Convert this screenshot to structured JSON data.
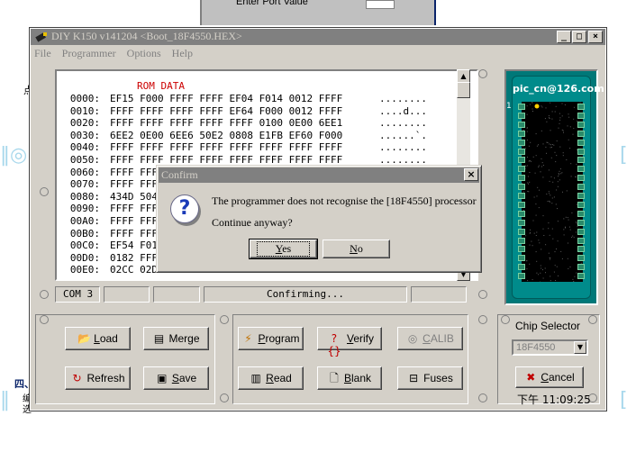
{
  "background": {
    "top_label": "Enter Port Value",
    "left_char": "点",
    "bottom_text_1": "四、",
    "bottom_text_2": "编",
    "bottom_text_3": "选"
  },
  "window": {
    "title": "DIY K150 v141204  <Boot_18F4550.HEX>",
    "menu": [
      "File",
      "Programmer",
      "Options",
      "Help"
    ]
  },
  "hex": {
    "title": "ROM DATA",
    "rows": [
      {
        "addr": "0000:",
        "data": "EF15 F000 FFFF FFFF EF04 F014 0012 FFFF",
        "ascii": "........"
      },
      {
        "addr": "0010:",
        "data": "FFFF FFFF FFFF FFFF EF64 F000 0012 FFFF",
        "ascii": "....d..."
      },
      {
        "addr": "0020:",
        "data": "FFFF FFFF FFFF FFFF FFFF 0100 0E00 6EE1",
        "ascii": "........"
      },
      {
        "addr": "0030:",
        "data": "6EE2 0E00 6EE6 50E2 0808 E1FB EF60 F000",
        "ascii": "......`."
      },
      {
        "addr": "0040:",
        "data": "FFFF FFFF FFFF FFFF FFFF FFFF FFFF FFFF",
        "ascii": "........"
      },
      {
        "addr": "0050:",
        "data": "FFFF FFFF FFFF FFFF FFFF FFFF FFFF FFFF",
        "ascii": "........"
      },
      {
        "addr": "0060:",
        "data": "FFFF FFF",
        "ascii": ""
      },
      {
        "addr": "0070:",
        "data": "FFFF FFF",
        "ascii": ""
      },
      {
        "addr": "0080:",
        "data": "434D 504",
        "ascii": ""
      },
      {
        "addr": "0090:",
        "data": "FFFF FFF",
        "ascii": ""
      },
      {
        "addr": "00A0:",
        "data": "FFFF FFF",
        "ascii": ""
      },
      {
        "addr": "00B0:",
        "data": "FFFF FFF",
        "ascii": ""
      },
      {
        "addr": "00C0:",
        "data": "EF54 F01",
        "ascii": ""
      },
      {
        "addr": "00D0:",
        "data": "0182 FFF",
        "ascii": ""
      },
      {
        "addr": "00E0:",
        "data": "02CC 02D",
        "ascii": "........"
      }
    ]
  },
  "status": {
    "port": "COM 3",
    "message": "Confirming..."
  },
  "chip": {
    "brand": "pic_cn@126.com",
    "pin1": "1"
  },
  "buttons": {
    "load": "Load",
    "merge": "Merge",
    "refresh": "Refresh",
    "save": "Save",
    "program": "Program",
    "verify": "Verify",
    "calib": "CALIB",
    "read": "Read",
    "blank": "Blank",
    "fuses": "Fuses"
  },
  "chip_selector": {
    "label": "Chip Selector",
    "value": "18F4550",
    "cancel": "Cancel",
    "clock": "下午 11:09:25"
  },
  "dialog": {
    "title": "Confirm",
    "message": "The programmer does not recognise the [18F4550] processor",
    "question": "Continue anyway?",
    "yes": "Yes",
    "no": "No"
  }
}
